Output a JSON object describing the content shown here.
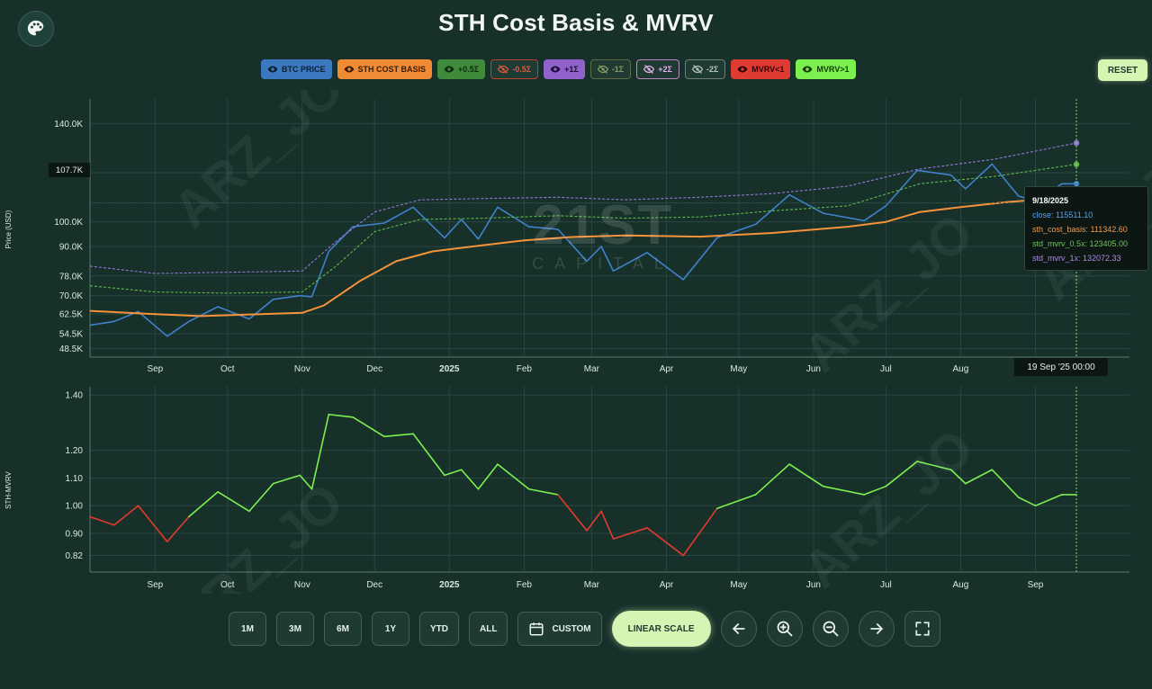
{
  "title": "STH Cost Basis & MVRV",
  "legend": [
    {
      "label": "BTC PRICE",
      "bg": "#3a78c0",
      "fg": "#0d1f33",
      "hidden": false
    },
    {
      "label": "STH COST BASIS",
      "bg": "#f08a34",
      "fg": "#3a1e05",
      "hidden": false
    },
    {
      "label": "+0.5Σ",
      "bg": "#3f8a3b",
      "fg": "#0f2a0e",
      "hidden": false
    },
    {
      "label": "-0.5Σ",
      "bg": "#1e3a33",
      "fg": "#e0593c",
      "hidden": true,
      "border": "#b9452e"
    },
    {
      "label": "+1Σ",
      "bg": "#8f63c9",
      "fg": "#1e0d36",
      "hidden": false
    },
    {
      "label": "-1Σ",
      "bg": "#1e3a33",
      "fg": "#8a9a5f",
      "hidden": true,
      "border": "#5d6b44"
    },
    {
      "label": "+2Σ",
      "bg": "#1e3a33",
      "fg": "#e4b3e8",
      "hidden": true,
      "border": "#b98ac2"
    },
    {
      "label": "-2Σ",
      "bg": "#1e3a33",
      "fg": "#b8c3c0",
      "hidden": true,
      "border": "#6f7c79"
    },
    {
      "label": "MVRV<1",
      "bg": "#e03b32",
      "fg": "#2b0605",
      "hidden": false
    },
    {
      "label": "MVRV>1",
      "bg": "#7bf04f",
      "fg": "#133a07",
      "hidden": false
    }
  ],
  "reset_label": "RESET",
  "price_badge": "107.7K",
  "time_badge": "19 Sep '25   00:00",
  "tooltip": {
    "date": "9/18/2025",
    "lines": [
      {
        "text": "close: 115511.10",
        "color": "#5aa0ea"
      },
      {
        "text": "sth_cost_basis: 111342.60",
        "color": "#f29a4c"
      },
      {
        "text": "std_mvrv_0.5x: 123405.00",
        "color": "#73c25f"
      },
      {
        "text": "std_mvrv_1x: 132072.33",
        "color": "#b08ae0"
      }
    ]
  },
  "watermark": {
    "name": "21ST",
    "sub": "CAPITAL",
    "handle": "ARZ_JO"
  },
  "toolbar": {
    "ranges": [
      "1M",
      "3M",
      "6M",
      "1Y",
      "YTD",
      "ALL"
    ],
    "custom_label": "CUSTOM",
    "scale_label": "LINEAR SCALE"
  },
  "colors": {
    "background": "#17302a",
    "price": "#3f82cc",
    "cost_basis": "#f5923a",
    "plus_half_sigma": "#5fb84a",
    "plus_one_sigma": "#8f78d8",
    "mvrv_above": "#7cf04f",
    "mvrv_below": "#e33a2f",
    "grid": "#2a4640"
  },
  "chart_data": [
    {
      "type": "line",
      "title": "STH Cost Basis & MVRV",
      "ylabel": "Price (USD)",
      "yticks": [
        48500,
        54500,
        62500,
        70000,
        78000,
        90000,
        100000,
        107700,
        120000,
        140000
      ],
      "ytick_labels": [
        "48.5K",
        "54.5K",
        "62.5K",
        "70.0K",
        "78.0K",
        "90.0K",
        "100.0K",
        "107.7K",
        "120.0K",
        "140.0K"
      ],
      "ylim": [
        45000,
        150000
      ],
      "xlim": [
        "2024-08-05",
        "2025-10-10"
      ],
      "xtick_labels": [
        "Sep",
        "Oct",
        "Nov",
        "Dec",
        "2025",
        "Feb",
        "Mar",
        "Apr",
        "May",
        "Jun",
        "Jul",
        "Aug",
        "Sep"
      ],
      "xtick_dates": [
        "2024-09-01",
        "2024-10-01",
        "2024-11-01",
        "2024-12-01",
        "2025-01-01",
        "2025-02-01",
        "2025-03-01",
        "2025-04-01",
        "2025-05-01",
        "2025-06-01",
        "2025-07-01",
        "2025-08-01",
        "2025-09-01"
      ],
      "series": [
        {
          "name": "BTC PRICE",
          "color": "#3f82cc",
          "points": [
            [
              "2024-08-05",
              58000
            ],
            [
              "2024-08-15",
              59500
            ],
            [
              "2024-08-25",
              63500
            ],
            [
              "2024-09-06",
              53500
            ],
            [
              "2024-09-15",
              59500
            ],
            [
              "2024-09-27",
              65500
            ],
            [
              "2024-10-10",
              60500
            ],
            [
              "2024-10-20",
              68500
            ],
            [
              "2024-10-31",
              70000
            ],
            [
              "2024-11-05",
              69500
            ],
            [
              "2024-11-12",
              88000
            ],
            [
              "2024-11-22",
              98000
            ],
            [
              "2024-12-05",
              99500
            ],
            [
              "2024-12-17",
              106000
            ],
            [
              "2024-12-30",
              93500
            ],
            [
              "2025-01-06",
              101000
            ],
            [
              "2025-01-13",
              93000
            ],
            [
              "2025-01-21",
              106000
            ],
            [
              "2025-02-03",
              98000
            ],
            [
              "2025-02-15",
              97000
            ],
            [
              "2025-02-27",
              84000
            ],
            [
              "2025-03-05",
              90000
            ],
            [
              "2025-03-10",
              80000
            ],
            [
              "2025-03-24",
              87500
            ],
            [
              "2025-04-08",
              76500
            ],
            [
              "2025-04-22",
              93500
            ],
            [
              "2025-05-08",
              99000
            ],
            [
              "2025-05-22",
              111000
            ],
            [
              "2025-06-05",
              103500
            ],
            [
              "2025-06-22",
              100500
            ],
            [
              "2025-07-01",
              106500
            ],
            [
              "2025-07-14",
              121000
            ],
            [
              "2025-07-28",
              119000
            ],
            [
              "2025-08-03",
              113500
            ],
            [
              "2025-08-14",
              123500
            ],
            [
              "2025-08-25",
              110500
            ],
            [
              "2025-09-01",
              108500
            ],
            [
              "2025-09-12",
              115500
            ],
            [
              "2025-09-18",
              115511.1
            ]
          ]
        },
        {
          "name": "STH COST BASIS",
          "color": "#f5923a",
          "points": [
            [
              "2024-08-05",
              63800
            ],
            [
              "2024-09-01",
              62500
            ],
            [
              "2024-09-20",
              61700
            ],
            [
              "2024-10-15",
              62500
            ],
            [
              "2024-11-01",
              63000
            ],
            [
              "2024-11-10",
              66000
            ],
            [
              "2024-11-25",
              76000
            ],
            [
              "2024-12-10",
              84000
            ],
            [
              "2024-12-25",
              88000
            ],
            [
              "2025-01-15",
              90500
            ],
            [
              "2025-02-01",
              92500
            ],
            [
              "2025-02-20",
              93800
            ],
            [
              "2025-03-15",
              94500
            ],
            [
              "2025-04-15",
              94000
            ],
            [
              "2025-05-15",
              95500
            ],
            [
              "2025-06-15",
              98000
            ],
            [
              "2025-07-01",
              100000
            ],
            [
              "2025-07-15",
              104000
            ],
            [
              "2025-08-01",
              106000
            ],
            [
              "2025-08-20",
              108000
            ],
            [
              "2025-09-01",
              109000
            ],
            [
              "2025-09-18",
              111342.6
            ]
          ]
        },
        {
          "name": "+0.5Σ",
          "color": "#5fb84a",
          "points": [
            [
              "2024-08-05",
              74000
            ],
            [
              "2024-09-01",
              71500
            ],
            [
              "2024-10-01",
              71000
            ],
            [
              "2024-11-01",
              71500
            ],
            [
              "2024-11-15",
              82000
            ],
            [
              "2024-12-01",
              96000
            ],
            [
              "2024-12-20",
              101000
            ],
            [
              "2025-01-15",
              101500
            ],
            [
              "2025-02-15",
              102500
            ],
            [
              "2025-03-15",
              101500
            ],
            [
              "2025-04-15",
              102000
            ],
            [
              "2025-05-15",
              104500
            ],
            [
              "2025-06-15",
              106500
            ],
            [
              "2025-07-15",
              115500
            ],
            [
              "2025-08-15",
              118500
            ],
            [
              "2025-09-18",
              123405
            ]
          ]
        },
        {
          "name": "+1Σ",
          "color": "#8f78d8",
          "points": [
            [
              "2024-08-05",
              82000
            ],
            [
              "2024-09-01",
              79000
            ],
            [
              "2024-10-01",
              79500
            ],
            [
              "2024-11-01",
              80000
            ],
            [
              "2024-11-15",
              92000
            ],
            [
              "2024-12-01",
              104000
            ],
            [
              "2024-12-20",
              109000
            ],
            [
              "2025-01-15",
              109500
            ],
            [
              "2025-02-15",
              110000
            ],
            [
              "2025-03-15",
              109000
            ],
            [
              "2025-04-15",
              110000
            ],
            [
              "2025-05-15",
              111500
            ],
            [
              "2025-06-15",
              114500
            ],
            [
              "2025-07-15",
              121500
            ],
            [
              "2025-08-15",
              125500
            ],
            [
              "2025-09-18",
              132072.33
            ]
          ]
        }
      ]
    },
    {
      "type": "line",
      "ylabel": "STH-MVRV",
      "yticks": [
        0.82,
        0.9,
        1.0,
        1.1,
        1.2,
        1.4
      ],
      "ytick_labels": [
        "0.82",
        "0.90",
        "1.00",
        "1.10",
        "1.20",
        "1.40"
      ],
      "ylim": [
        0.76,
        1.43
      ],
      "xlim": [
        "2024-08-05",
        "2025-10-10"
      ],
      "xtick_labels": [
        "Sep",
        "Oct",
        "Nov",
        "Dec",
        "2025",
        "Feb",
        "Mar",
        "Apr",
        "May",
        "Jun",
        "Jul",
        "Aug",
        "Sep"
      ],
      "xtick_dates": [
        "2024-09-01",
        "2024-10-01",
        "2024-11-01",
        "2024-12-01",
        "2025-01-01",
        "2025-02-01",
        "2025-03-01",
        "2025-04-01",
        "2025-05-01",
        "2025-06-01",
        "2025-07-01",
        "2025-08-01",
        "2025-09-01"
      ],
      "threshold": 1.0,
      "series": [
        {
          "name": "STH-MVRV",
          "color_above": "#7cf04f",
          "color_below": "#e33a2f",
          "points": [
            [
              "2024-08-05",
              0.96
            ],
            [
              "2024-08-15",
              0.93
            ],
            [
              "2024-08-25",
              1.0
            ],
            [
              "2024-09-06",
              0.87
            ],
            [
              "2024-09-15",
              0.96
            ],
            [
              "2024-09-27",
              1.05
            ],
            [
              "2024-10-10",
              0.98
            ],
            [
              "2024-10-20",
              1.08
            ],
            [
              "2024-10-31",
              1.11
            ],
            [
              "2024-11-05",
              1.06
            ],
            [
              "2024-11-12",
              1.33
            ],
            [
              "2024-11-22",
              1.32
            ],
            [
              "2024-12-05",
              1.25
            ],
            [
              "2024-12-17",
              1.26
            ],
            [
              "2024-12-30",
              1.11
            ],
            [
              "2025-01-06",
              1.13
            ],
            [
              "2025-01-13",
              1.06
            ],
            [
              "2025-01-21",
              1.15
            ],
            [
              "2025-02-03",
              1.06
            ],
            [
              "2025-02-15",
              1.04
            ],
            [
              "2025-02-27",
              0.91
            ],
            [
              "2025-03-05",
              0.98
            ],
            [
              "2025-03-10",
              0.88
            ],
            [
              "2025-03-24",
              0.92
            ],
            [
              "2025-04-08",
              0.82
            ],
            [
              "2025-04-22",
              0.99
            ],
            [
              "2025-05-08",
              1.04
            ],
            [
              "2025-05-22",
              1.15
            ],
            [
              "2025-06-05",
              1.07
            ],
            [
              "2025-06-22",
              1.04
            ],
            [
              "2025-07-01",
              1.07
            ],
            [
              "2025-07-14",
              1.16
            ],
            [
              "2025-07-28",
              1.13
            ],
            [
              "2025-08-03",
              1.08
            ],
            [
              "2025-08-14",
              1.13
            ],
            [
              "2025-08-25",
              1.03
            ],
            [
              "2025-09-01",
              1.0
            ],
            [
              "2025-09-12",
              1.04
            ],
            [
              "2025-09-18",
              1.04
            ]
          ]
        }
      ]
    }
  ]
}
